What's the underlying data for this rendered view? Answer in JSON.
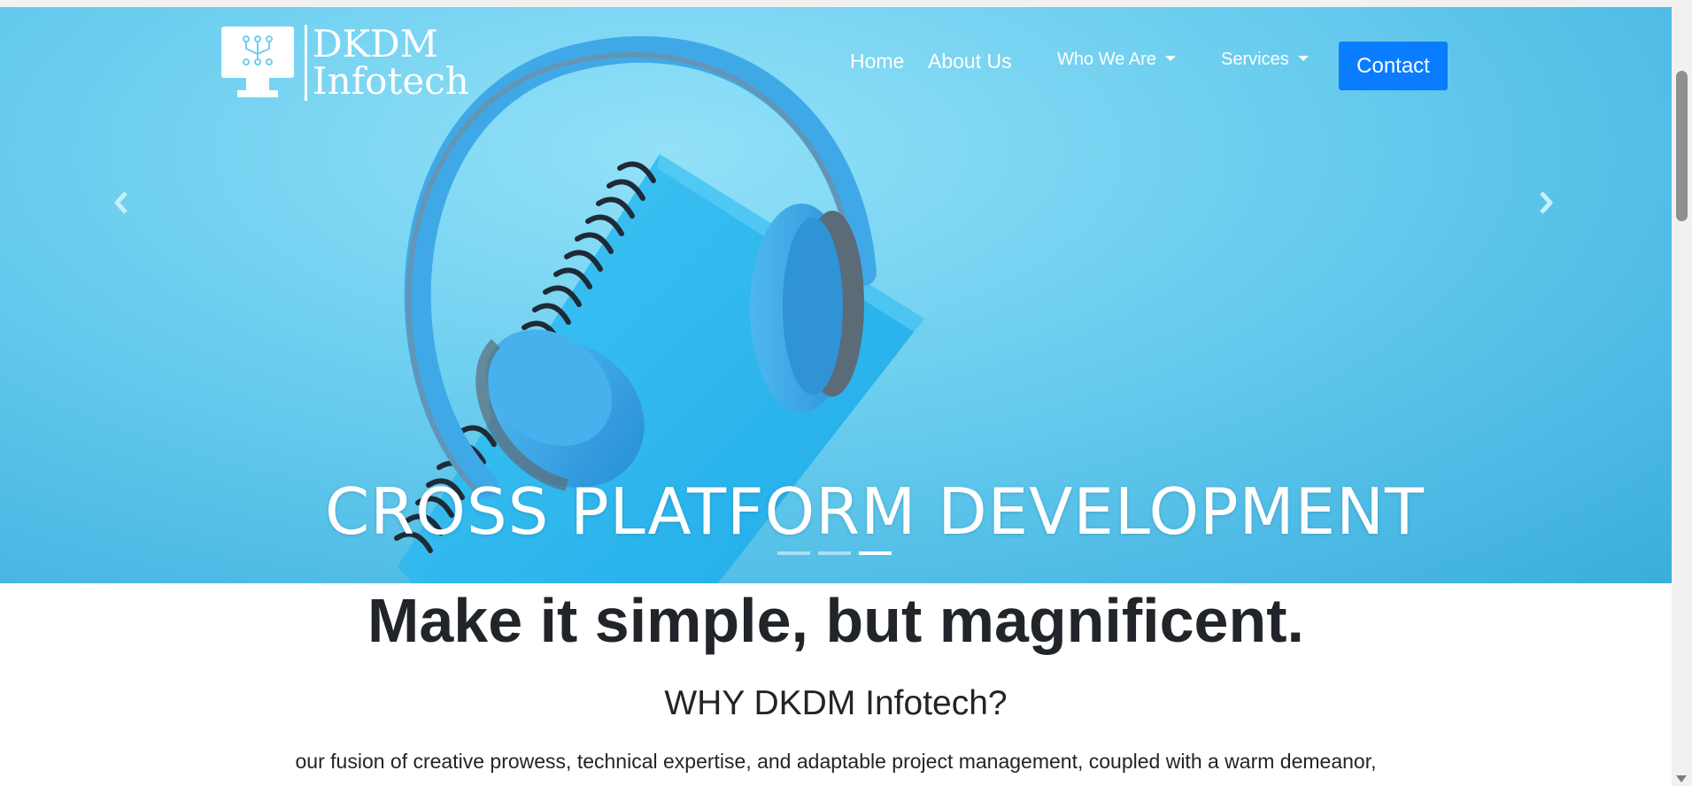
{
  "brand": {
    "line1": "DKDM",
    "line2": "Infotech",
    "logo_icon": "monitor-circuit-icon"
  },
  "nav": {
    "home": "Home",
    "about": "About Us",
    "who": "Who We Are",
    "services": "Services",
    "contact": "Contact"
  },
  "carousel": {
    "caption": "CROSS PLATFORM DEVELOPMENT",
    "slide_count": 3,
    "active_slide": 3,
    "prev_icon": "chevron-left-icon",
    "next_icon": "chevron-right-icon"
  },
  "main": {
    "headline": "Make it simple, but magnificent.",
    "subhead": "WHY DKDM Infotech?",
    "paragraph": "our fusion of creative prowess, technical expertise, and adaptable project management, coupled with a warm demeanor,"
  },
  "colors": {
    "accent": "#0a7cff",
    "hero": "#6ecfef",
    "text": "#212529"
  }
}
